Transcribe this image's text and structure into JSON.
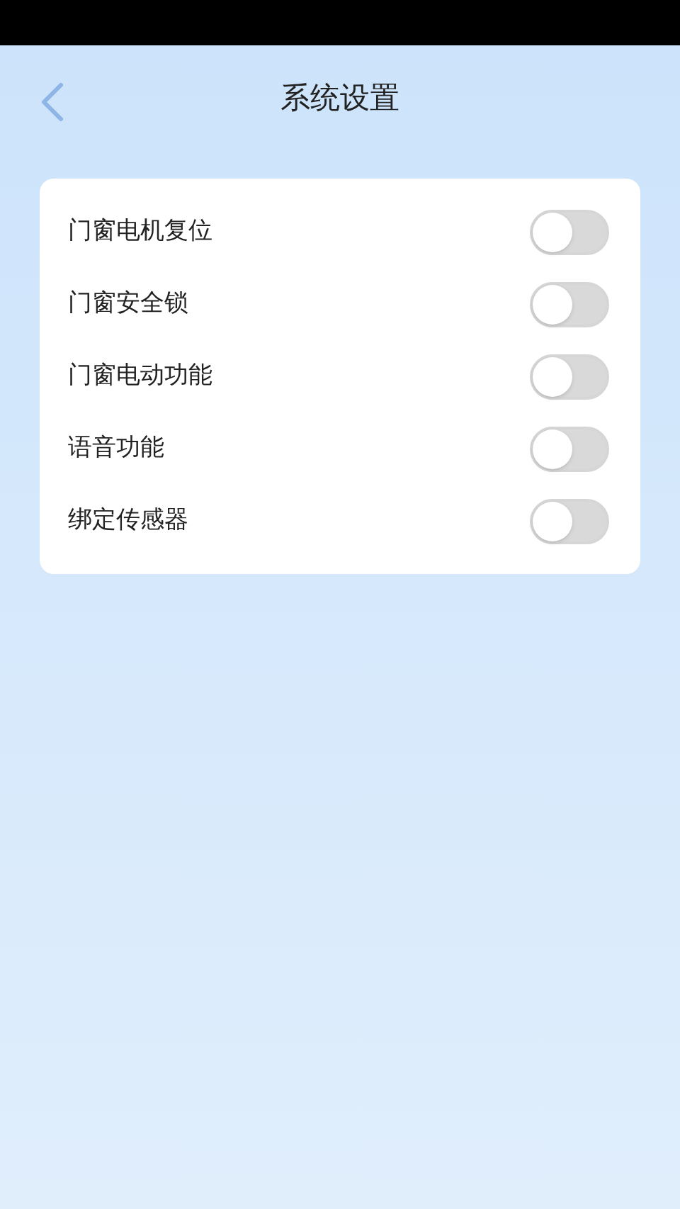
{
  "header": {
    "title": "系统设置"
  },
  "settings": [
    {
      "label": "门窗电机复位",
      "on": false
    },
    {
      "label": "门窗安全锁",
      "on": false
    },
    {
      "label": "门窗电动功能",
      "on": false
    },
    {
      "label": "语音功能",
      "on": false
    },
    {
      "label": "绑定传感器",
      "on": false
    }
  ]
}
